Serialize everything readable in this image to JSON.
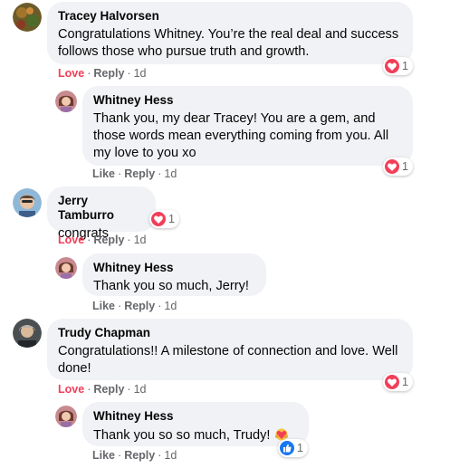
{
  "comments": [
    {
      "author": "Tracey Halvorsen",
      "text": "Congratulations Whitney. You’re the real deal and success follows those who pursue truth and growth.",
      "reaction_count": "1",
      "actions": {
        "primary": "Love",
        "reply": "Reply",
        "time": "1d"
      },
      "reply": {
        "author": "Whitney Hess",
        "text": "Thank you, my dear Tracey! You are a gem, and those words mean everything coming from you. All my love to you xo",
        "reaction_count": "1",
        "actions": {
          "primary": "Like",
          "reply": "Reply",
          "time": "1d"
        }
      }
    },
    {
      "author": "Jerry Tamburro",
      "text": "congrats",
      "reaction_count": "1",
      "actions": {
        "primary": "Love",
        "reply": "Reply",
        "time": "1d"
      },
      "reply": {
        "author": "Whitney Hess",
        "text": "Thank you so much, Jerry!",
        "actions": {
          "primary": "Like",
          "reply": "Reply",
          "time": "1d"
        }
      }
    },
    {
      "author": "Trudy Chapman",
      "text": "Congratulations!! A milestone of connection and love. Well done!",
      "reaction_count": "1",
      "actions": {
        "primary": "Love",
        "reply": "Reply",
        "time": "1d"
      },
      "reply": {
        "author": "Whitney Hess",
        "text": "Thank you so so much, Trudy!",
        "reaction_count": "1",
        "actions": {
          "primary": "Like",
          "reply": "Reply",
          "time": "1d"
        }
      }
    }
  ],
  "separator": "·",
  "colors": {
    "love": "#f33e58",
    "like": "#1877f2",
    "bubble": "#f0f2f5",
    "meta": "#65676b"
  },
  "icons": {
    "love_reaction": "heart-icon",
    "like_reaction": "thumbs-up-icon",
    "inline_emoji": "heart-hug-emoji-icon"
  }
}
